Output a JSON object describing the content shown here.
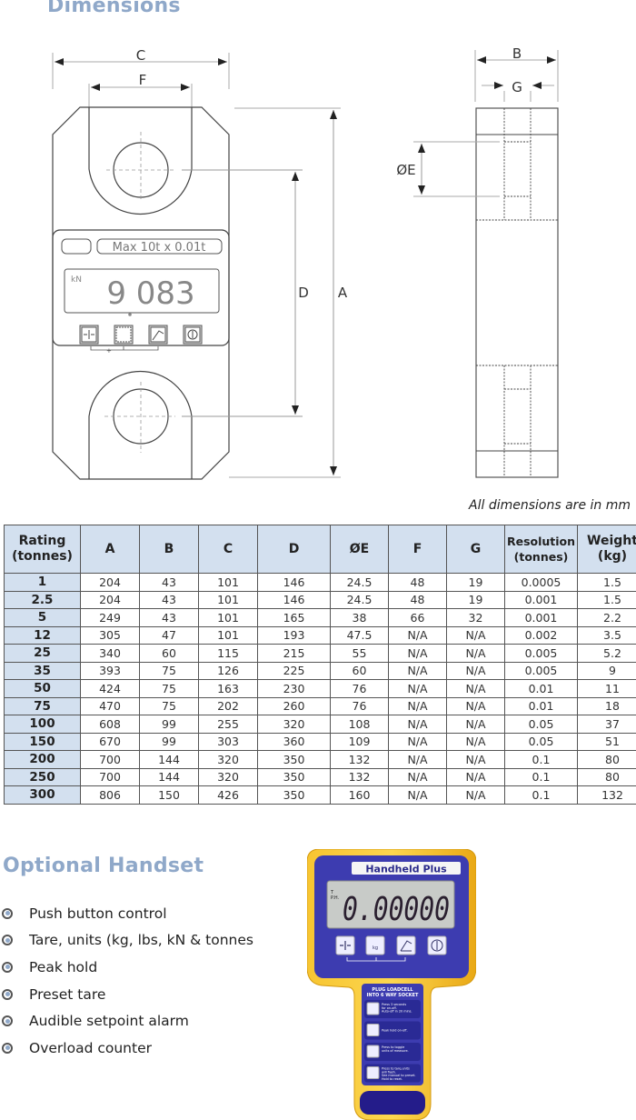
{
  "sections": {
    "dimensions_title": "Dimensions",
    "handset_title": "Optional Handset"
  },
  "drawing": {
    "labels": {
      "C": "C",
      "F": "F",
      "B": "B",
      "G": "G",
      "E": "ØE",
      "D": "D",
      "A": "A"
    },
    "device": {
      "capacity_label": "Max 10t x 0.01t",
      "unit": "kN",
      "reading": "9 083"
    }
  },
  "units_note": "All dimensions are in mm",
  "table": {
    "headers": [
      [
        "Rating",
        "(tonnes)"
      ],
      [
        "A"
      ],
      [
        "B"
      ],
      [
        "C"
      ],
      [
        "D"
      ],
      [
        "ØE"
      ],
      [
        "F"
      ],
      [
        "G"
      ],
      [
        "Resolution",
        "(tonnes)"
      ],
      [
        "Weight",
        "(kg)"
      ]
    ],
    "rows": [
      [
        "1",
        "204",
        "43",
        "101",
        "146",
        "24.5",
        "48",
        "19",
        "0.0005",
        "1.5"
      ],
      [
        "2.5",
        "204",
        "43",
        "101",
        "146",
        "24.5",
        "48",
        "19",
        "0.001",
        "1.5"
      ],
      [
        "5",
        "249",
        "43",
        "101",
        "165",
        "38",
        "66",
        "32",
        "0.001",
        "2.2"
      ],
      [
        "12",
        "305",
        "47",
        "101",
        "193",
        "47.5",
        "N/A",
        "N/A",
        "0.002",
        "3.5"
      ],
      [
        "25",
        "340",
        "60",
        "115",
        "215",
        "55",
        "N/A",
        "N/A",
        "0.005",
        "5.2"
      ],
      [
        "35",
        "393",
        "75",
        "126",
        "225",
        "60",
        "N/A",
        "N/A",
        "0.005",
        "9"
      ],
      [
        "50",
        "424",
        "75",
        "163",
        "230",
        "76",
        "N/A",
        "N/A",
        "0.01",
        "11"
      ],
      [
        "75",
        "470",
        "75",
        "202",
        "260",
        "76",
        "N/A",
        "N/A",
        "0.01",
        "18"
      ],
      [
        "100",
        "608",
        "99",
        "255",
        "320",
        "108",
        "N/A",
        "N/A",
        "0.05",
        "37"
      ],
      [
        "150",
        "670",
        "99",
        "303",
        "360",
        "109",
        "N/A",
        "N/A",
        "0.05",
        "51"
      ],
      [
        "200",
        "700",
        "144",
        "320",
        "350",
        "132",
        "N/A",
        "N/A",
        "0.1",
        "80"
      ],
      [
        "250",
        "700",
        "144",
        "320",
        "350",
        "132",
        "N/A",
        "N/A",
        "0.1",
        "80"
      ],
      [
        "300",
        "806",
        "150",
        "426",
        "350",
        "160",
        "N/A",
        "N/A",
        "0.1",
        "132"
      ]
    ]
  },
  "features": [
    "Push button control",
    "Tare, units (kg, lbs, kN & tonnes",
    "Peak hold",
    "Preset tare",
    "Audible setpoint alarm",
    "Overload counter"
  ],
  "handset": {
    "brand_label": "Handheld Plus",
    "lcd_indicators": [
      "T",
      "P.H."
    ],
    "lcd_reading": "0.00000",
    "socket_label_line1": "PLUG LOADCELL",
    "socket_label_line2": "INTO 6 WAY SOCKET",
    "instructions": [
      {
        "icon": "power-icon",
        "lines": [
          "Press 3 seconds",
          "for on-off.",
          "Auto-off in 20 mins."
        ]
      },
      {
        "icon": "peak-hold-icon",
        "lines": [
          "Peak hold on-off."
        ]
      },
      {
        "icon": "units-icon",
        "lines": [
          "Press to toggle",
          "units of measure."
        ]
      },
      {
        "icon": "tare-icon",
        "lines": [
          "Press to tare,units",
          "will flash.",
          "See manual to preset.",
          "Hold to reset."
        ]
      }
    ]
  },
  "colors": {
    "heading_blue": "#8fa8c9",
    "table_header_bg": "#d3e0ef",
    "handset_yellow": "#f5b81c",
    "handset_blue": "#3a3aa8",
    "handset_dark_blue": "#241c8a"
  }
}
